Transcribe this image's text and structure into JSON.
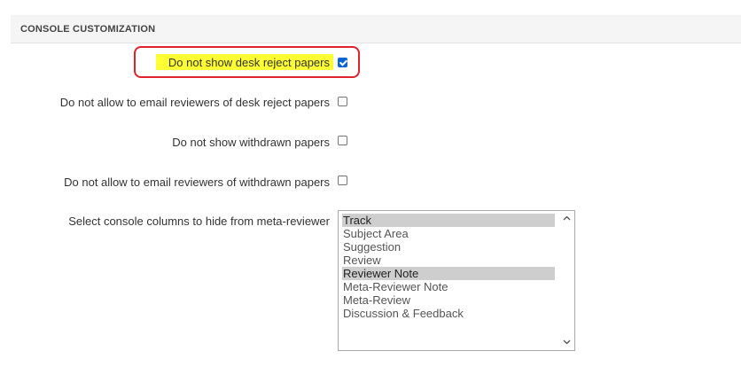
{
  "section": {
    "title": "CONSOLE CUSTOMIZATION"
  },
  "options": {
    "hide_desk_reject": {
      "label": "Do not show desk reject papers",
      "checked": true
    },
    "no_email_desk_reject": {
      "label": "Do not allow to email reviewers of desk reject papers",
      "checked": false
    },
    "hide_withdrawn": {
      "label": "Do not show withdrawn papers",
      "checked": false
    },
    "no_email_withdrawn": {
      "label": "Do not allow to email reviewers of withdrawn papers",
      "checked": false
    }
  },
  "columns_select": {
    "label": "Select console columns to hide from meta-reviewer",
    "items": [
      {
        "label": "Track",
        "selected": true
      },
      {
        "label": "Subject Area",
        "selected": false
      },
      {
        "label": "Suggestion",
        "selected": false
      },
      {
        "label": "Review",
        "selected": false
      },
      {
        "label": "Reviewer Note",
        "selected": true
      },
      {
        "label": "Meta-Reviewer Note",
        "selected": false
      },
      {
        "label": "Meta-Review",
        "selected": false
      },
      {
        "label": "Discussion & Feedback",
        "selected": false
      }
    ]
  },
  "icons": {
    "scroll_up": "chevron-up-icon",
    "scroll_down": "chevron-down-icon"
  },
  "colors": {
    "highlight": "#ffff33",
    "annotation_border": "#e0212e",
    "checkbox_checked": "#0b64d6"
  }
}
